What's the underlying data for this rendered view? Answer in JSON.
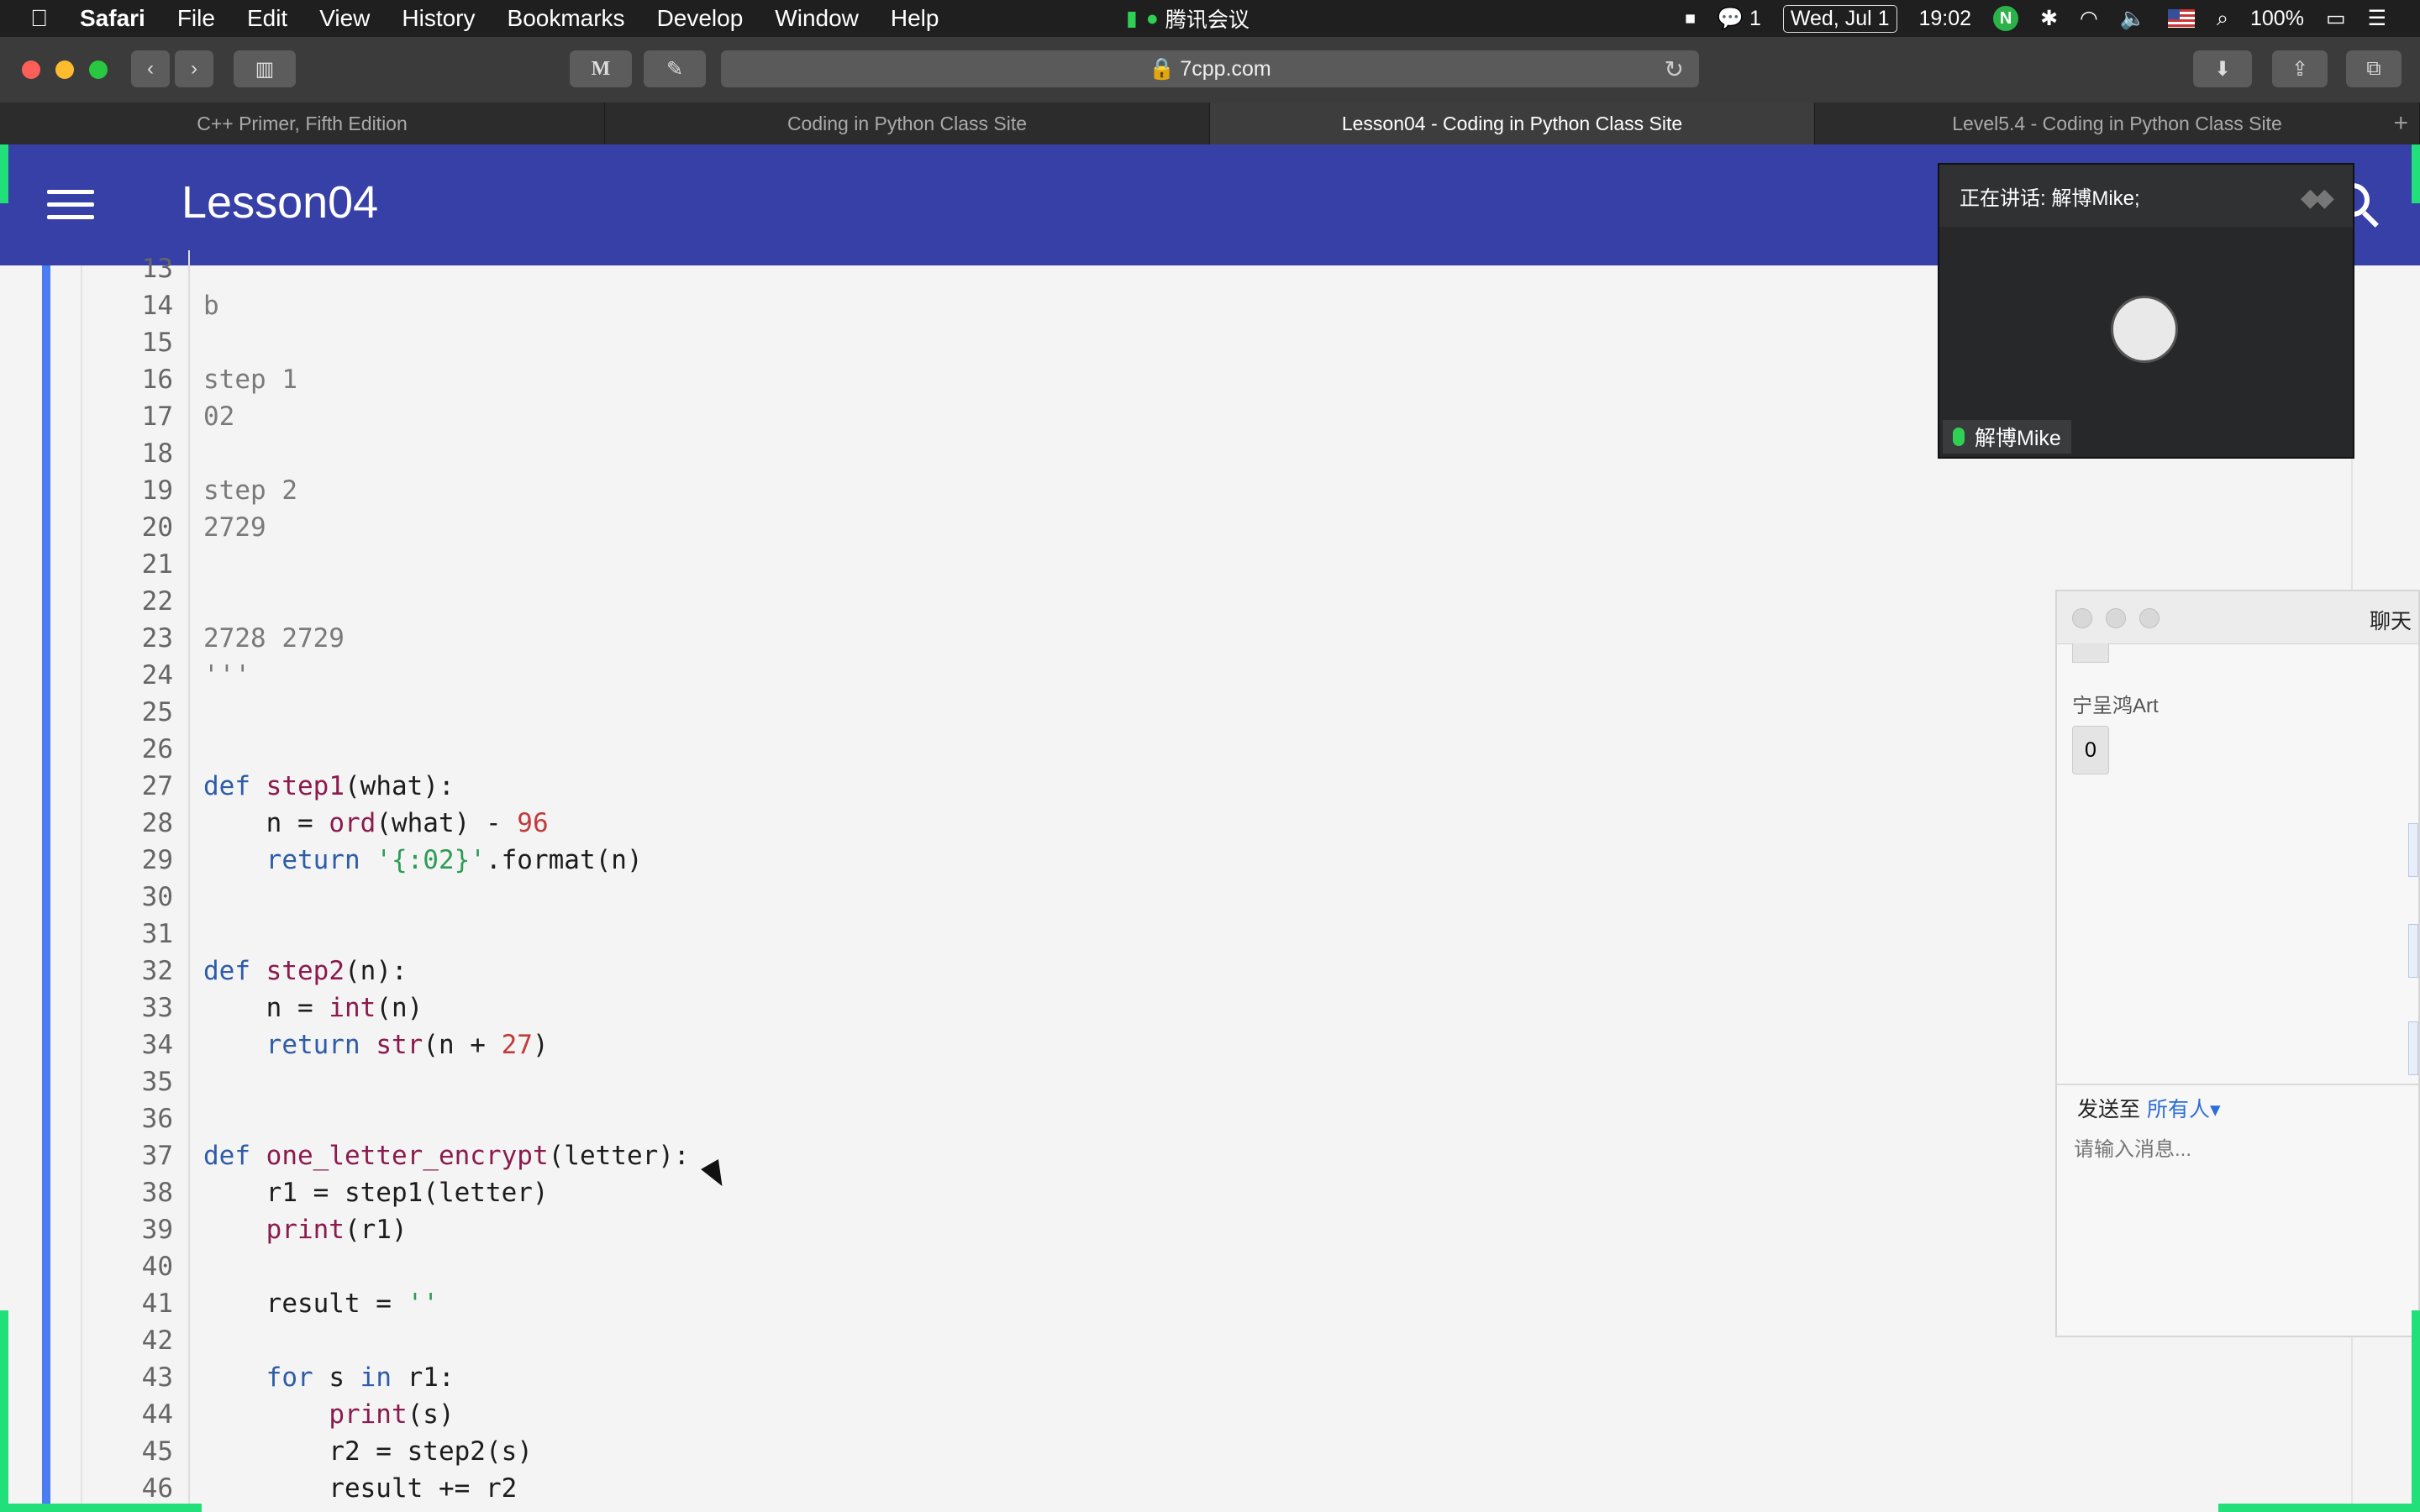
{
  "menubar": {
    "app": "Safari",
    "menus": [
      "File",
      "Edit",
      "View",
      "History",
      "Bookmarks",
      "Develop",
      "Window",
      "Help"
    ],
    "meeting_app": "腾讯会议",
    "wechat_count": "1",
    "date": "Wed, Jul 1",
    "time": "19:02",
    "n_icon": "N",
    "battery": "100%"
  },
  "toolbar": {
    "url": "7cpp.com",
    "m_button": "M"
  },
  "tabs": [
    {
      "label": "C++ Primer, Fifth Edition"
    },
    {
      "label": "Coding in Python Class Site"
    },
    {
      "label": "Lesson04 - Coding in Python Class Site"
    },
    {
      "label": "Level5.4 - Coding in Python Class Site"
    }
  ],
  "header": {
    "title": "Lesson04"
  },
  "code_lines": [
    {
      "n": "13",
      "t": ""
    },
    {
      "n": "14",
      "t": "b"
    },
    {
      "n": "15",
      "t": ""
    },
    {
      "n": "16",
      "t": "step 1"
    },
    {
      "n": "17",
      "t": "02"
    },
    {
      "n": "18",
      "t": ""
    },
    {
      "n": "19",
      "t": "step 2"
    },
    {
      "n": "20",
      "t": "2729"
    },
    {
      "n": "21",
      "t": ""
    },
    {
      "n": "22",
      "t": ""
    },
    {
      "n": "23",
      "t": "2728 2729"
    },
    {
      "n": "24",
      "t": "'''"
    },
    {
      "n": "25",
      "t": ""
    },
    {
      "n": "26",
      "t": ""
    },
    {
      "n": "27",
      "t": "def step1(what):"
    },
    {
      "n": "28",
      "t": "    n = ord(what) - 96"
    },
    {
      "n": "29",
      "t": "    return '{:02}'.format(n)"
    },
    {
      "n": "30",
      "t": ""
    },
    {
      "n": "31",
      "t": ""
    },
    {
      "n": "32",
      "t": "def step2(n):"
    },
    {
      "n": "33",
      "t": "    n = int(n)"
    },
    {
      "n": "34",
      "t": "    return str(n + 27)"
    },
    {
      "n": "35",
      "t": ""
    },
    {
      "n": "36",
      "t": ""
    },
    {
      "n": "37",
      "t": "def one_letter_encrypt(letter):"
    },
    {
      "n": "38",
      "t": "    r1 = step1(letter)"
    },
    {
      "n": "39",
      "t": "    print(r1)"
    },
    {
      "n": "40",
      "t": ""
    },
    {
      "n": "41",
      "t": "    result = ''"
    },
    {
      "n": "42",
      "t": ""
    },
    {
      "n": "43",
      "t": "    for s in r1:"
    },
    {
      "n": "44",
      "t": "        print(s)"
    },
    {
      "n": "45",
      "t": "        r2 = step2(s)"
    },
    {
      "n": "46",
      "t": "        result += r2"
    }
  ],
  "video": {
    "speaking": "正在讲话: 解博Mike;",
    "speaker": "解博Mike"
  },
  "chat": {
    "title": "聊天",
    "sender": "宁呈鸿Art",
    "message": "0",
    "send_to_label": "发送至",
    "send_to_target": "所有人",
    "placeholder": "请输入消息..."
  },
  "colors": {
    "header_bg": "#3740a6",
    "accent_bar": "#4a7cf2",
    "keyword": "#2d5ca8",
    "function": "#8b1a4d",
    "number": "#c23b3b",
    "string": "#2e9c57",
    "recording_marker": "#21e07a"
  }
}
